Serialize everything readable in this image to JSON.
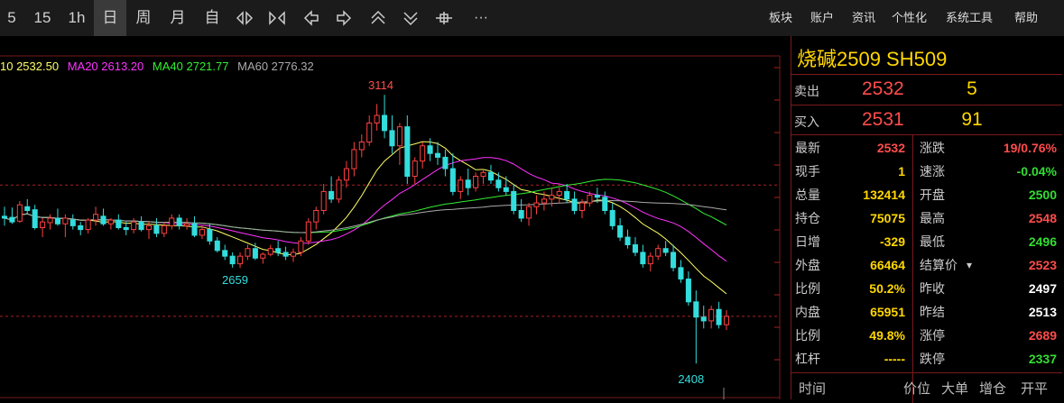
{
  "toolbar": {
    "periods": [
      "5",
      "15",
      "1h",
      "日",
      "周",
      "月",
      "自"
    ],
    "active_period": "日",
    "icons": [
      "expand-horizontal-icon",
      "collapse-horizontal-icon",
      "arrow-left-icon",
      "arrow-right-icon",
      "chevron-up-double-icon",
      "chevron-down-double-icon",
      "crosshair-icon",
      "more-icon"
    ],
    "more_label": "···",
    "menu": [
      "板块",
      "账户",
      "资讯",
      "个性化",
      "系统工具",
      "帮助"
    ]
  },
  "ma_legend": [
    {
      "text": "10 2532.50",
      "color": "#ffff66"
    },
    {
      "text": "MA20 2613.20",
      "color": "#ff33ff"
    },
    {
      "text": "MA40 2721.77",
      "color": "#33ee33"
    },
    {
      "text": "MA60 2776.32",
      "color": "#aaaaaa"
    }
  ],
  "chart_data": {
    "type": "candlestick",
    "up_color": "#ff4040",
    "down_color": "#33dddd",
    "high_label": "3114",
    "low_labels": [
      "2659",
      "2408"
    ],
    "reference_lines": [
      2877,
      2532
    ],
    "candles": [
      [
        2795,
        2820,
        2770,
        2790
      ],
      [
        2792,
        2818,
        2775,
        2780
      ],
      [
        2782,
        2835,
        2778,
        2825
      ],
      [
        2820,
        2840,
        2800,
        2810
      ],
      [
        2812,
        2825,
        2760,
        2765
      ],
      [
        2765,
        2790,
        2740,
        2780
      ],
      [
        2778,
        2800,
        2760,
        2790
      ],
      [
        2790,
        2815,
        2770,
        2775
      ],
      [
        2775,
        2800,
        2740,
        2790
      ],
      [
        2785,
        2800,
        2760,
        2770
      ],
      [
        2770,
        2780,
        2745,
        2760
      ],
      [
        2760,
        2790,
        2750,
        2785
      ],
      [
        2785,
        2820,
        2770,
        2800
      ],
      [
        2795,
        2815,
        2770,
        2775
      ],
      [
        2775,
        2790,
        2760,
        2785
      ],
      [
        2785,
        2800,
        2760,
        2765
      ],
      [
        2765,
        2780,
        2745,
        2760
      ],
      [
        2760,
        2790,
        2750,
        2780
      ],
      [
        2780,
        2795,
        2755,
        2760
      ],
      [
        2760,
        2780,
        2735,
        2770
      ],
      [
        2770,
        2790,
        2740,
        2750
      ],
      [
        2750,
        2780,
        2740,
        2770
      ],
      [
        2770,
        2800,
        2760,
        2790
      ],
      [
        2790,
        2800,
        2760,
        2770
      ],
      [
        2770,
        2790,
        2760,
        2775
      ],
      [
        2775,
        2795,
        2740,
        2745
      ],
      [
        2745,
        2770,
        2735,
        2760
      ],
      [
        2760,
        2775,
        2720,
        2730
      ],
      [
        2730,
        2740,
        2700,
        2705
      ],
      [
        2705,
        2720,
        2680,
        2690
      ],
      [
        2690,
        2700,
        2660,
        2670
      ],
      [
        2670,
        2700,
        2659,
        2690
      ],
      [
        2690,
        2720,
        2680,
        2710
      ],
      [
        2710,
        2725,
        2680,
        2685
      ],
      [
        2685,
        2700,
        2670,
        2695
      ],
      [
        2695,
        2720,
        2690,
        2710
      ],
      [
        2710,
        2730,
        2690,
        2700
      ],
      [
        2700,
        2715,
        2680,
        2690
      ],
      [
        2690,
        2710,
        2675,
        2700
      ],
      [
        2700,
        2740,
        2690,
        2730
      ],
      [
        2730,
        2790,
        2720,
        2780
      ],
      [
        2780,
        2820,
        2760,
        2810
      ],
      [
        2810,
        2880,
        2800,
        2860
      ],
      [
        2860,
        2900,
        2830,
        2840
      ],
      [
        2840,
        2900,
        2830,
        2890
      ],
      [
        2890,
        2940,
        2870,
        2920
      ],
      [
        2920,
        2990,
        2900,
        2970
      ],
      [
        2970,
        3010,
        2950,
        2990
      ],
      [
        2990,
        3060,
        2980,
        3040
      ],
      [
        3040,
        3090,
        3020,
        3060
      ],
      [
        3060,
        3114,
        3000,
        3020
      ],
      [
        3020,
        3060,
        2960,
        2980
      ],
      [
        2980,
        3040,
        2930,
        3030
      ],
      [
        3030,
        3060,
        2880,
        2900
      ],
      [
        2900,
        2950,
        2880,
        2940
      ],
      [
        2940,
        2990,
        2920,
        2980
      ],
      [
        2980,
        3000,
        2940,
        2960
      ],
      [
        2960,
        2990,
        2930,
        2950
      ],
      [
        2950,
        2970,
        2900,
        2920
      ],
      [
        2920,
        2960,
        2850,
        2860
      ],
      [
        2860,
        2900,
        2840,
        2890
      ],
      [
        2890,
        2920,
        2850,
        2870
      ],
      [
        2870,
        2910,
        2860,
        2900
      ],
      [
        2900,
        2920,
        2880,
        2910
      ],
      [
        2910,
        2930,
        2880,
        2890
      ],
      [
        2890,
        2910,
        2860,
        2870
      ],
      [
        2870,
        2900,
        2850,
        2860
      ],
      [
        2860,
        2880,
        2800,
        2810
      ],
      [
        2810,
        2840,
        2780,
        2790
      ],
      [
        2790,
        2830,
        2770,
        2820
      ],
      [
        2820,
        2850,
        2800,
        2830
      ],
      [
        2830,
        2860,
        2810,
        2840
      ],
      [
        2840,
        2870,
        2820,
        2850
      ],
      [
        2850,
        2870,
        2830,
        2860
      ],
      [
        2860,
        2880,
        2830,
        2840
      ],
      [
        2840,
        2860,
        2800,
        2810
      ],
      [
        2810,
        2840,
        2790,
        2830
      ],
      [
        2830,
        2860,
        2820,
        2850
      ],
      [
        2850,
        2870,
        2830,
        2845
      ],
      [
        2845,
        2860,
        2800,
        2810
      ],
      [
        2810,
        2830,
        2760,
        2770
      ],
      [
        2770,
        2790,
        2730,
        2740
      ],
      [
        2740,
        2760,
        2710,
        2720
      ],
      [
        2720,
        2740,
        2690,
        2700
      ],
      [
        2700,
        2720,
        2660,
        2670
      ],
      [
        2670,
        2700,
        2650,
        2690
      ],
      [
        2690,
        2720,
        2680,
        2710
      ],
      [
        2710,
        2730,
        2690,
        2700
      ],
      [
        2700,
        2720,
        2650,
        2660
      ],
      [
        2660,
        2680,
        2620,
        2630
      ],
      [
        2630,
        2650,
        2560,
        2570
      ],
      [
        2570,
        2600,
        2408,
        2530
      ],
      [
        2530,
        2560,
        2500,
        2520
      ],
      [
        2520,
        2560,
        2500,
        2550
      ],
      [
        2550,
        2570,
        2500,
        2510
      ],
      [
        2510,
        2548,
        2496,
        2532
      ]
    ]
  },
  "panel": {
    "title": "烧碱2509  SH509",
    "sell": {
      "label": "卖出",
      "price": "2532",
      "vol": "5"
    },
    "buy": {
      "label": "买入",
      "price": "2531",
      "vol": "91"
    },
    "left_rows": [
      {
        "label": "最新",
        "value": "2532",
        "color": "#ff4c4c"
      },
      {
        "label": "现手",
        "value": "1",
        "color": "#ffd700"
      },
      {
        "label": "总量",
        "value": "132414",
        "color": "#ffd700"
      },
      {
        "label": "持仓",
        "value": "75075",
        "color": "#ffd700"
      },
      {
        "label": "日增",
        "value": "-329",
        "color": "#ffd700"
      },
      {
        "label": "外盘",
        "value": "66464",
        "color": "#ffd700"
      },
      {
        "label": "比例",
        "value": "50.2%",
        "color": "#ffd700"
      },
      {
        "label": "内盘",
        "value": "65951",
        "color": "#ffd700"
      },
      {
        "label": "比例",
        "value": "49.8%",
        "color": "#ffd700"
      },
      {
        "label": "杠杆",
        "value": "-----",
        "color": "#ffd700"
      }
    ],
    "right_rows": [
      {
        "label": "涨跌",
        "value": "19/0.76%",
        "color": "#ff4c4c"
      },
      {
        "label": "速涨",
        "value": "-0.04%",
        "color": "#33dd33"
      },
      {
        "label": "开盘",
        "value": "2500",
        "color": "#33dd33"
      },
      {
        "label": "最高",
        "value": "2548",
        "color": "#ff4c4c"
      },
      {
        "label": "最低",
        "value": "2496",
        "color": "#33dd33"
      },
      {
        "label": "结算价",
        "value": "2523",
        "color": "#ff4c4c"
      },
      {
        "label": "昨收",
        "value": "2497",
        "color": "#ffffff"
      },
      {
        "label": "昨结",
        "value": "2513",
        "color": "#ffffff"
      },
      {
        "label": "涨停",
        "value": "2689",
        "color": "#ff4c4c"
      },
      {
        "label": "跌停",
        "value": "2337",
        "color": "#33dd33"
      }
    ],
    "bottom": [
      "时间",
      "价位",
      "大单",
      "增仓",
      "开平"
    ]
  }
}
